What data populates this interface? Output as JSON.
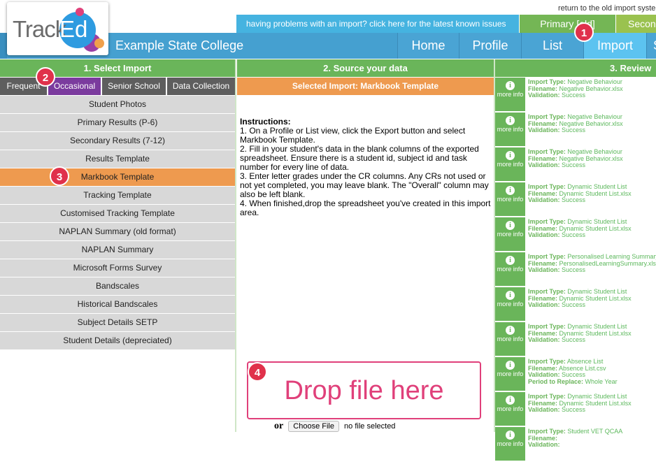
{
  "header": {
    "return_link": "return to the old import system",
    "problem_banner": "having problems with an import?  click here for the latest known issues",
    "primary_pill": "Primary [old]",
    "secondary_pill": "Secondary [old]",
    "logo_track": "Track",
    "logo_ed": "Ed",
    "school_name": "Example State College",
    "nav": [
      "Home",
      "Profile",
      "List",
      "Import",
      "Setup"
    ]
  },
  "badges": [
    "1",
    "2",
    "3",
    "4"
  ],
  "panel1": {
    "title": "1. Select Import",
    "tabs": [
      "Frequent",
      "Occasional",
      "Senior School",
      "Data Collection"
    ],
    "active_tab": "Occasional",
    "items": [
      "Student Photos",
      "Primary Results (P-6)",
      "Secondary Results (7-12)",
      "Results Template",
      "Markbook Template",
      "Tracking Template",
      "Customised Tracking Template",
      "NAPLAN Summary (old format)",
      "NAPLAN Summary",
      "Microsoft Forms Survey",
      "Bandscales",
      "Historical Bandscales",
      "Subject Details SETP",
      "Student Details (depreciated)"
    ],
    "selected_item": "Markbook Template"
  },
  "panel2": {
    "title": "2. Source your data",
    "selected_import": "Selected Import:  Markbook Template",
    "instructions_title": "Instructions:",
    "instructions": [
      "1.  On a Profile or List view, click the Export button and select Markbook Template.",
      "2.  Fill in your student's data in the blank columns of the exported spreadsheet.  Ensure there is a student id, subject id and task number for every line of data.",
      "3.  Enter letter grades under the CR columns.  Any CRs not used or not yet completed, you may leave blank.  The \"Overall\" column may also be left blank.",
      "4.  When finished,drop the spreadsheet you've created in this import area."
    ],
    "drop_label": "Drop file here",
    "or_label": "or",
    "choose_file": "Choose File",
    "no_file": "no file selected"
  },
  "panel3": {
    "title": "3.  Review",
    "more_info_label": "more info",
    "info_glyph": "i",
    "field_labels": {
      "type": "Import Type:",
      "file": "Filename:",
      "validation": "Validation:",
      "period": "Period to Replace:"
    },
    "items": [
      {
        "type": "Negative Behaviour",
        "file": "Negative Behavior.xlsx",
        "validation": "Success"
      },
      {
        "type": "Negative Behaviour",
        "file": "Negative Behavior.xlsx",
        "validation": "Success"
      },
      {
        "type": "Negative Behaviour",
        "file": "Negative Behavior.xlsx",
        "validation": "Success"
      },
      {
        "type": "Dynamic Student List",
        "file": "Dynamic Student List.xlsx",
        "validation": "Success"
      },
      {
        "type": "Dynamic Student List",
        "file": "Dynamic Student List.xlsx",
        "validation": "Success"
      },
      {
        "type": "Personalised Learning Summary",
        "file": "PersonalisedLearningSummary.xlsx",
        "validation": "Success"
      },
      {
        "type": "Dynamic Student List",
        "file": "Dynamic Student List.xlsx",
        "validation": "Success"
      },
      {
        "type": "Dynamic Student List",
        "file": "Dynamic Student List.xlsx",
        "validation": "Success"
      },
      {
        "type": "Absence List",
        "file": "Absence List.csv",
        "validation": "Success",
        "period": "Whole Year"
      },
      {
        "type": "Dynamic Student List",
        "file": "Dynamic Student List.xlsx",
        "validation": "Success"
      },
      {
        "type": "Student VET QCAA",
        "file": "",
        "validation": ""
      }
    ]
  },
  "colors": {
    "green": "#6ab55a",
    "blue": "#45a0d0",
    "orange": "#ee9a4f",
    "purple": "#7b3b9e",
    "badge_red": "#e0314b",
    "drop_pink": "#e0407a"
  }
}
